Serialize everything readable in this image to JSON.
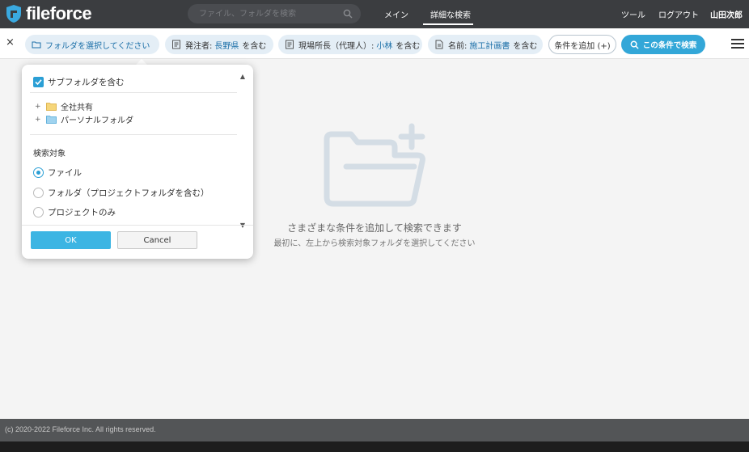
{
  "header": {
    "logo_text": "fileforce",
    "search_placeholder": "ファイル、フォルダを検索",
    "nav": {
      "main": "メイン",
      "advanced_search": "詳細な検索",
      "tools": "ツール",
      "logout": "ログアウト",
      "user": "山田次郎"
    }
  },
  "filter_bar": {
    "close_label": "×",
    "folder_chip": "フォルダを選択してください",
    "chips": [
      {
        "field": "発注者:",
        "value": "長野県",
        "suffix": "を含む"
      },
      {
        "field": "現場所長（代理人）:",
        "value": "小林",
        "suffix": "を含む"
      },
      {
        "field": "名前:",
        "value": "施工計画書",
        "suffix": "を含む"
      }
    ],
    "add_condition": "条件を追加 (+)",
    "search_button": "この条件で検索"
  },
  "empty_state": {
    "title": "さまざまな条件を追加して検索できます",
    "subtitle": "最初に、左上から検索対象フォルダを選択してください"
  },
  "popup": {
    "include_subfolders": "サブフォルダを含む",
    "include_subfolders_checked": true,
    "tree": [
      {
        "label": "全社共有",
        "expander": "+"
      },
      {
        "label": "パーソナルフォルダ",
        "expander": "+"
      }
    ],
    "target_title": "検索対象",
    "options": [
      {
        "label": "ファイル",
        "selected": true
      },
      {
        "label": "フォルダ（プロジェクトフォルダを含む）",
        "selected": false
      },
      {
        "label": "プロジェクトのみ",
        "selected": false
      }
    ],
    "ok": "OK",
    "cancel": "Cancel"
  },
  "footer": {
    "copyright": "(c) 2020-2022 Fileforce Inc. All rights reserved."
  },
  "colors": {
    "topbar": "#3b3d40",
    "accent": "#33a7d8",
    "chip_bg": "#e4eef6",
    "chip_value": "#1b6fa8",
    "footer": "#535557"
  }
}
